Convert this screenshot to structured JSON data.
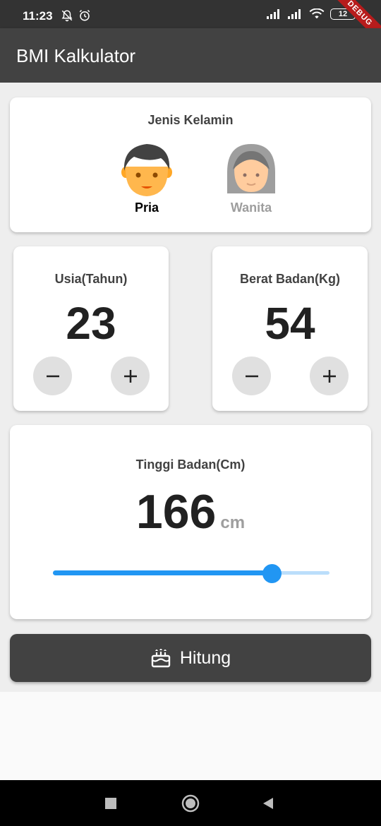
{
  "status_bar": {
    "time": "11:23",
    "battery": "12",
    "left_icons": [
      "bell-off-icon",
      "alarm-icon"
    ],
    "right_icons": [
      "signal-icon",
      "signal-icon",
      "wifi-icon",
      "battery-icon"
    ]
  },
  "debug_banner": "DEBUG",
  "app_bar": {
    "title": "BMI Kalkulator"
  },
  "gender": {
    "title": "Jenis Kelamin",
    "options": [
      {
        "label": "Pria",
        "icon": "man-face-icon",
        "selected": true
      },
      {
        "label": "Wanita",
        "icon": "old-woman-face-icon",
        "selected": false
      }
    ]
  },
  "age": {
    "title": "Usia(Tahun)",
    "value": "23",
    "minus_icon": "minus-icon",
    "plus_icon": "plus-icon"
  },
  "weight": {
    "title": "Berat Badan(Kg)",
    "value": "54",
    "minus_icon": "minus-icon",
    "plus_icon": "plus-icon"
  },
  "height": {
    "title": "Tinggi Badan(Cm)",
    "value": "166",
    "unit": "cm",
    "slider_fraction": 0.79
  },
  "calculate_button": {
    "label": "Hitung",
    "icon": "cake-icon"
  },
  "nav_bar": {
    "buttons": [
      "recents-square-icon",
      "home-circle-icon",
      "back-triangle-icon"
    ]
  },
  "colors": {
    "app_bar": "#424242",
    "status_bar": "#333333",
    "background": "#eeeeee",
    "card": "#ffffff",
    "accent": "#2196f3",
    "slider_track": "#bbdefb",
    "button": "#424242",
    "inactive_text": "#9e9e9e"
  }
}
